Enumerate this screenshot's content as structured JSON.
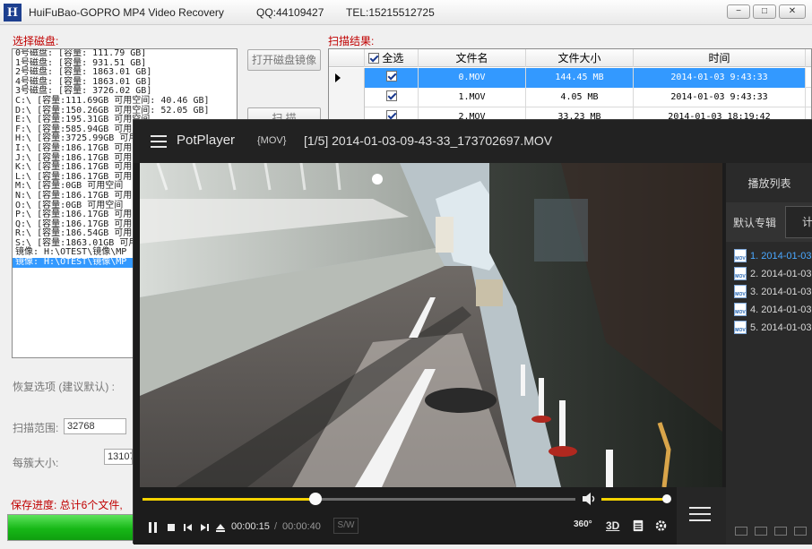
{
  "app": {
    "title": "HuiFuBao-GOPRO MP4 Video Recovery",
    "qq": "QQ:44109427",
    "tel": "TEL:15215512725",
    "minimize": "−",
    "maximize": "□",
    "close": "✕"
  },
  "disk_panel": {
    "label": "选择磁盘:",
    "items": [
      "0号磁盘: [容量: 111.79 GB]",
      "1号磁盘: [容量: 931.51 GB]",
      "2号磁盘: [容量: 1863.01 GB]",
      "4号磁盘: [容量: 1863.01 GB]",
      "3号磁盘: [容量: 3726.02 GB]",
      "C:\\ [容量:111.69GB 可用空间: 40.46 GB]",
      "D:\\ [容量:150.26GB 可用空间: 52.05 GB]",
      "E:\\ [容量:195.31GB 可用空间",
      "F:\\ [容量:585.94GB 可用空间",
      "H:\\ [容量:3725.99GB 可用空",
      "I:\\ [容量:186.17GB 可用空间",
      "J:\\ [容量:186.17GB 可用空间",
      "K:\\ [容量:186.17GB 可用空间",
      "L:\\ [容量:186.17GB 可用空间",
      "M:\\ [容量:0GB 可用空间",
      "N:\\ [容量:186.17GB 可用空间",
      "O:\\ [容量:0GB 可用空间",
      "P:\\ [容量:186.17GB 可用空间",
      "Q:\\ [容量:186.17GB 可用空间",
      "R:\\ [容量:186.54GB 可用空间",
      "S:\\ [容量:1863.01GB 可用",
      "镜像: H:\\OTEST\\镜像\\MP",
      "镜像: H:\\OTEST\\镜像\\MP"
    ],
    "selected_index": 22,
    "open_image_button": "打开磁盘镜像",
    "scan_button": "扫 描"
  },
  "options": {
    "group_label": "恢复选项 (建议默认) :",
    "range_label": "扫描范围:",
    "range_value": "32768",
    "cluster_label": "每簇大小:",
    "cluster_value": "13107"
  },
  "progress": {
    "label": "保存进度: 总计6个文件,",
    "fraction": 1.0
  },
  "results": {
    "label": "扫描结果:",
    "headers": {
      "select_all": "全选",
      "name": "文件名",
      "size": "文件大小",
      "time": "时间"
    },
    "rows": [
      {
        "name": "0.MOV",
        "size": "144.45 MB",
        "time": "2014-01-03 9:43:33",
        "checked": true,
        "selected": true
      },
      {
        "name": "1.MOV",
        "size": "4.05 MB",
        "time": "2014-01-03 9:43:33",
        "checked": true,
        "selected": false
      },
      {
        "name": "2.MOV",
        "size": "33.23 MB",
        "time": "2014-01-03 18:19:42",
        "checked": true,
        "selected": false
      }
    ]
  },
  "player": {
    "brand": "PotPlayer",
    "format": "{MOV}",
    "file_title": "[1/5] 2014-01-03-09-43-33_173702697.MOV",
    "time_current": "00:00:15",
    "time_separator": "/",
    "time_total": "00:00:40",
    "seek_fraction": 0.4,
    "volume_fraction": 1.0,
    "sw_label": "S/W",
    "btn_360": "360°",
    "btn_3d": "3D",
    "playlist": {
      "title": "播放列表",
      "tab_default": "默认专辑",
      "tab_other": "计",
      "file_icon_text": "MOV",
      "items": [
        "1. 2014-01-03",
        "2. 2014-01-03",
        "3. 2014-01-03",
        "4. 2014-01-03",
        "5. 2014-01-03"
      ],
      "current_index": 0
    }
  }
}
